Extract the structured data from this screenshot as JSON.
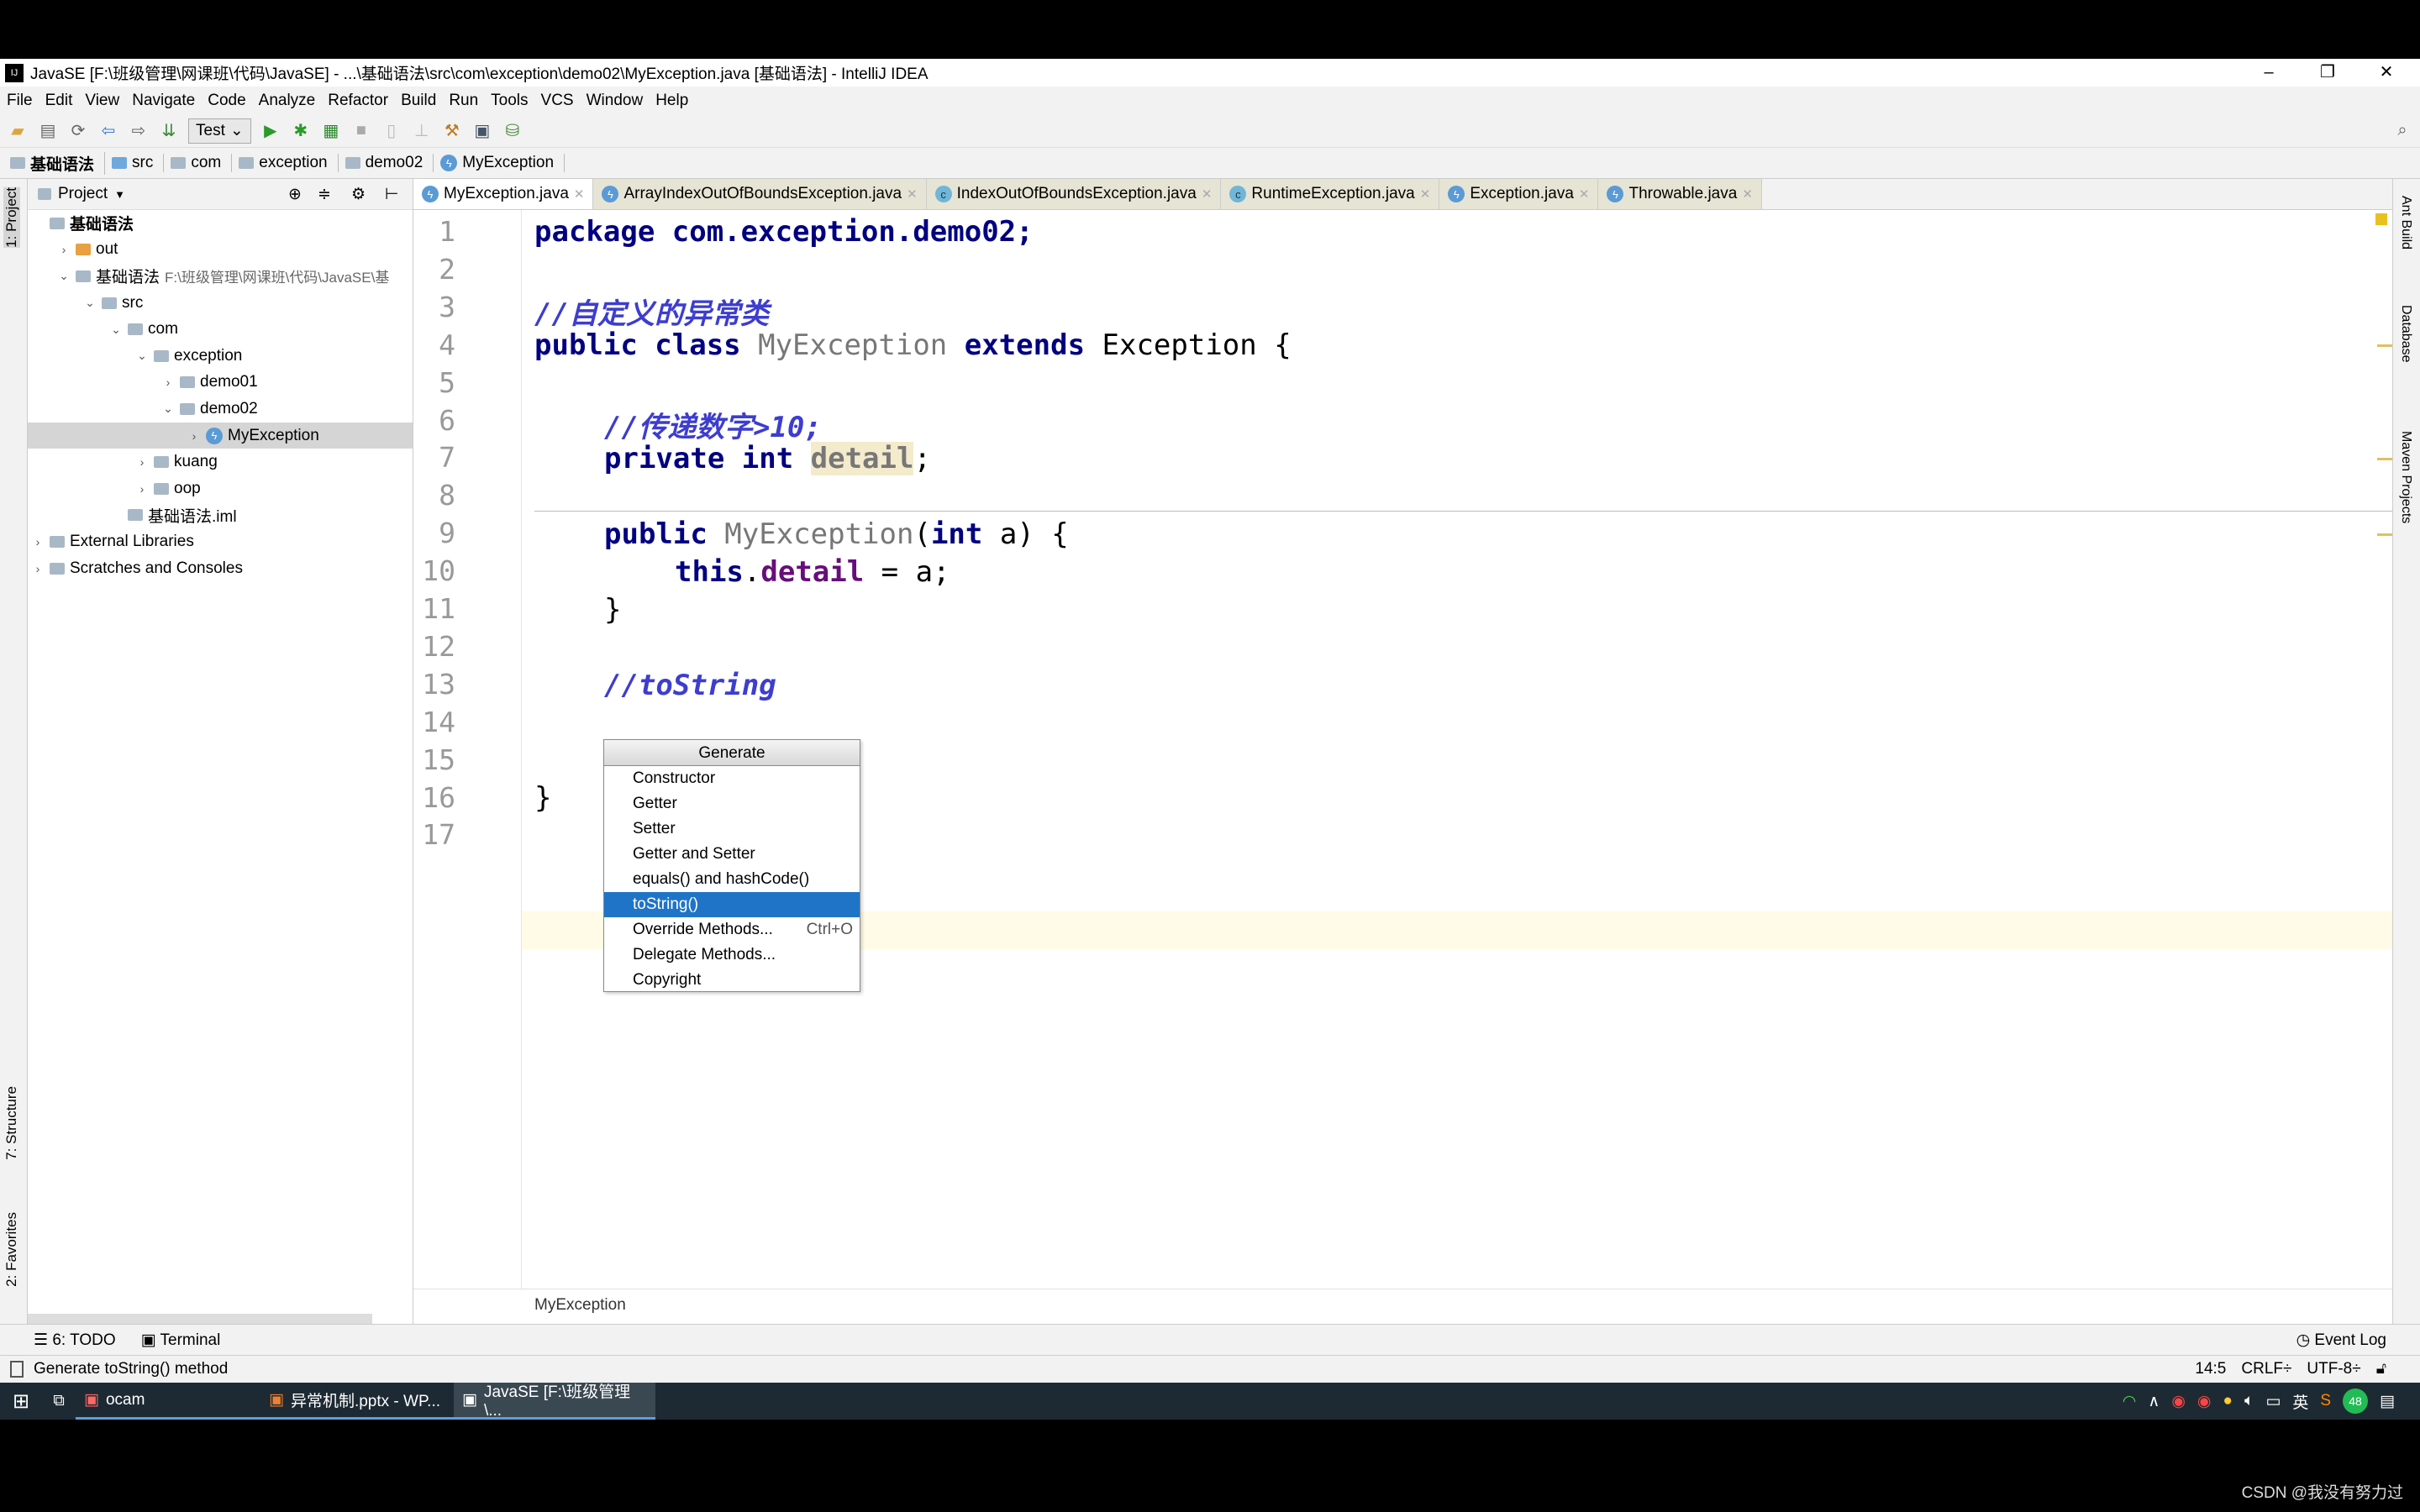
{
  "window": {
    "title": "JavaSE [F:\\班级管理\\网课班\\代码\\JavaSE] - ...\\基础语法\\src\\com\\exception\\demo02\\MyException.java [基础语法] - IntelliJ IDEA",
    "minimize": "–",
    "restore": "❐",
    "close": "✕"
  },
  "menu": [
    "File",
    "Edit",
    "View",
    "Navigate",
    "Code",
    "Analyze",
    "Refactor",
    "Build",
    "Run",
    "Tools",
    "VCS",
    "Window",
    "Help"
  ],
  "toolbar": {
    "run_config": "Test"
  },
  "breadcrumbs": [
    "基础语法",
    "src",
    "com",
    "exception",
    "demo02",
    "MyException"
  ],
  "project": {
    "title": "Project",
    "tree": [
      {
        "label": "基础语法",
        "depth": 0,
        "arrow": "",
        "type": "module"
      },
      {
        "label": "out",
        "depth": 1,
        "arrow": "›",
        "type": "folder-orange"
      },
      {
        "label": "基础语法",
        "extra": "F:\\班级管理\\网课班\\代码\\JavaSE\\基",
        "depth": 1,
        "arrow": "⌄",
        "type": "module"
      },
      {
        "label": "src",
        "depth": 2,
        "arrow": "⌄",
        "type": "folder"
      },
      {
        "label": "com",
        "depth": 3,
        "arrow": "⌄",
        "type": "folder"
      },
      {
        "label": "exception",
        "depth": 4,
        "arrow": "⌄",
        "type": "folder"
      },
      {
        "label": "demo01",
        "depth": 5,
        "arrow": "›",
        "type": "folder"
      },
      {
        "label": "demo02",
        "depth": 5,
        "arrow": "⌄",
        "type": "folder"
      },
      {
        "label": "MyException",
        "depth": 6,
        "arrow": "›",
        "type": "class",
        "selected": true
      },
      {
        "label": "kuang",
        "depth": 4,
        "arrow": "›",
        "type": "folder"
      },
      {
        "label": "oop",
        "depth": 4,
        "arrow": "›",
        "type": "folder"
      },
      {
        "label": "基础语法.iml",
        "depth": 3,
        "arrow": "",
        "type": "file"
      },
      {
        "label": "External Libraries",
        "depth": 0,
        "arrow": "›",
        "type": "lib"
      },
      {
        "label": "Scratches and Consoles",
        "depth": 0,
        "arrow": "›",
        "type": "scratch"
      }
    ]
  },
  "side_tabs": {
    "left": [
      "1: Project",
      "7: Structure",
      "2: Favorites"
    ],
    "right": [
      "Ant Build",
      "Database",
      "Maven Projects"
    ]
  },
  "tabs": [
    {
      "label": "MyException.java",
      "active": true
    },
    {
      "label": "ArrayIndexOutOfBoundsException.java"
    },
    {
      "label": "IndexOutOfBoundsException.java"
    },
    {
      "label": "RuntimeException.java"
    },
    {
      "label": "Exception.java"
    },
    {
      "label": "Throwable.java"
    }
  ],
  "code": {
    "lines": [
      "1",
      "2",
      "3",
      "4",
      "5",
      "6",
      "7",
      "8",
      "9",
      "10",
      "11",
      "12",
      "13",
      "14",
      "15",
      "16",
      "17"
    ],
    "l1": "package com.exception.demo02;",
    "l3": "//自定义的异常类",
    "l4a": "public class ",
    "l4b": "MyException",
    "l4c": " extends ",
    "l4d": "Exception {",
    "l6": "//传递数字>10;",
    "l7a": "private int ",
    "l7b": "detail",
    "l7c": ";",
    "l9a": "public ",
    "l9b": "MyException",
    "l9c": "(",
    "l9d": "int",
    "l9e": " a) {",
    "l10a": "this",
    "l10b": ".",
    "l10c": "detail",
    "l10d": " = a;",
    "l11": "}",
    "l13": "//toString",
    "l16": "}"
  },
  "editor_breadcrumb": "MyException",
  "popup": {
    "title": "Generate",
    "items": [
      {
        "label": "Constructor"
      },
      {
        "label": "Getter"
      },
      {
        "label": "Setter"
      },
      {
        "label": "Getter and Setter"
      },
      {
        "label": "equals() and hashCode()"
      },
      {
        "label": "toString()",
        "selected": true
      },
      {
        "label": "Override Methods...",
        "shortcut": "Ctrl+O"
      },
      {
        "label": "Delegate Methods..."
      },
      {
        "label": "Copyright"
      }
    ]
  },
  "bottom_tabs": {
    "todo": "6: TODO",
    "terminal": "Terminal",
    "event_log": "Event Log"
  },
  "status": {
    "message": "Generate toString() method",
    "position": "14:5",
    "line_sep": "CRLF÷",
    "encoding": "UTF-8÷"
  },
  "taskbar": {
    "items": [
      "ocam",
      "异常机制.pptx - WP...",
      "JavaSE [F:\\班级管理\\..."
    ],
    "ime": "英",
    "badge": "48"
  },
  "watermark": "CSDN @我没有努力过"
}
